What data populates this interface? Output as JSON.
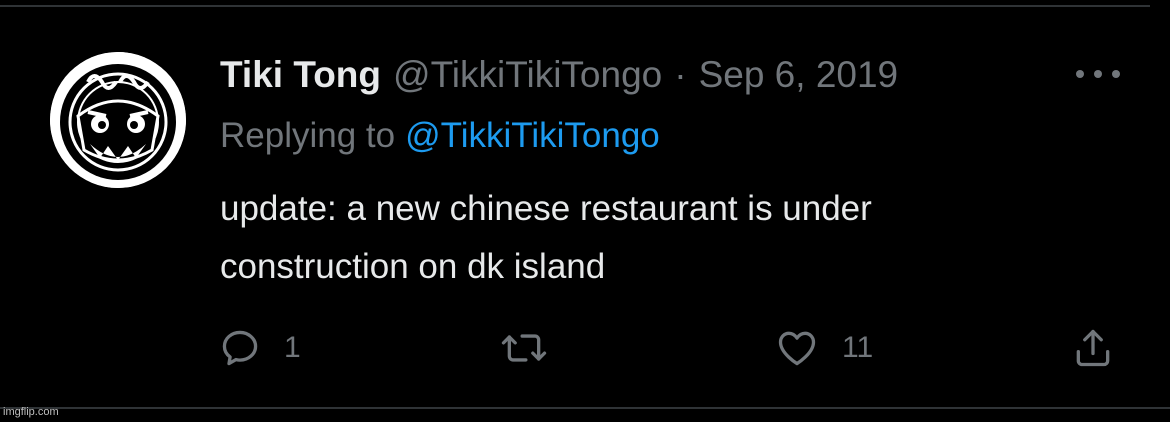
{
  "tweet": {
    "display_name": "Tiki Tong",
    "handle": "@TikkiTikiTongo",
    "separator": "·",
    "date": "Sep 6, 2019",
    "replying_prefix": "Replying to",
    "replying_handle": "@TikkiTikiTongo",
    "text_lines": [
      "update: a new chinese restaurant is under",
      "construction on dk island"
    ]
  },
  "actions": {
    "reply_count": "1",
    "retweet_count": "",
    "like_count": "11"
  },
  "icons": {
    "reply": "reply-icon",
    "retweet": "retweet-icon",
    "like": "heart-icon",
    "share": "share-icon",
    "more": "more-icon"
  },
  "colors": {
    "background": "#000000",
    "primary_text": "#e7e9ea",
    "secondary_text": "#71767b",
    "link": "#1d9bf0",
    "divider": "#2f3336"
  },
  "watermark": "imgflip.com"
}
